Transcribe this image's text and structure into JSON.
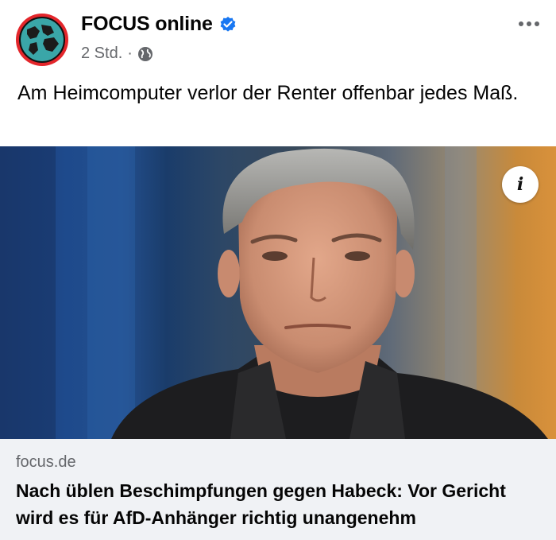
{
  "post": {
    "page_name": "FOCUS online",
    "verified_icon": "verified-badge-icon",
    "timestamp": "2 Std.",
    "separator": "·",
    "audience_icon": "globe-icon",
    "text": "Am Heimcomputer verlor der Renter offenbar jedes Maß."
  },
  "link": {
    "domain": "focus.de",
    "headline": "Nach üblen Beschimpfungen gegen Habeck: Vor Gericht wird es für AfD-Anhänger richtig unangenehm"
  },
  "photo": {
    "info_label": "i"
  },
  "colors": {
    "verified": "#1877f2",
    "avatar_ring": "#e3262b",
    "meta_text": "#65676b",
    "card_bg": "#f0f2f5"
  }
}
